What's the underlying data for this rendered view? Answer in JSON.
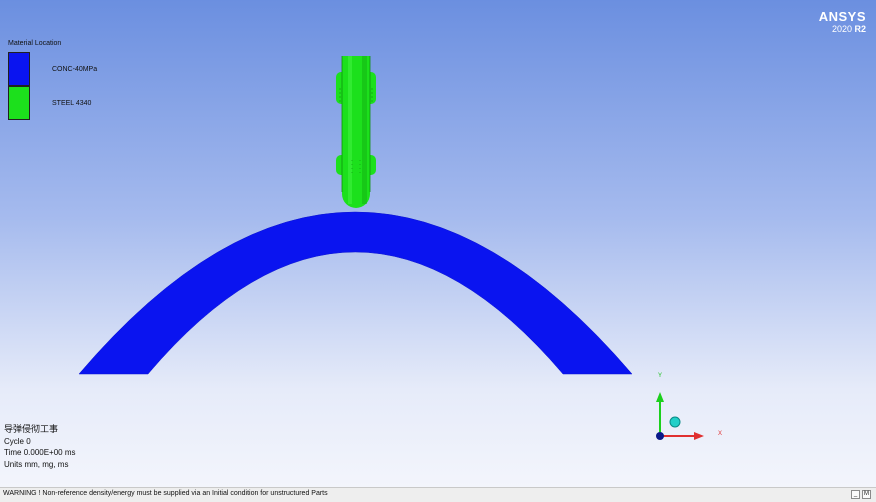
{
  "legend": {
    "title": "Material Location",
    "items": [
      {
        "label": "CONC-40MPa",
        "color": "#0a14f0"
      },
      {
        "label": "STEEL 4340",
        "color": "#1ce01c"
      }
    ]
  },
  "logo": {
    "brand": "ANSYS",
    "year": "2020",
    "release": "R2"
  },
  "info": {
    "title": "导弹侵彻工事",
    "cycle": "Cycle 0",
    "time": "Time 0.000E+00 ms",
    "units": "Units mm, mg, ms"
  },
  "triad": {
    "x_label": "X",
    "y_label": "Y"
  },
  "status": {
    "message": "WARNING ! Non-reference density/energy must be supplied via an Initial condition for unstructured Parts",
    "minimize_label": "_",
    "maximize_label": "M"
  },
  "colors": {
    "concrete": "#0a14f0",
    "steel": "#1ce01c",
    "x_axis": "#e03030",
    "y_axis": "#1cd01c"
  }
}
